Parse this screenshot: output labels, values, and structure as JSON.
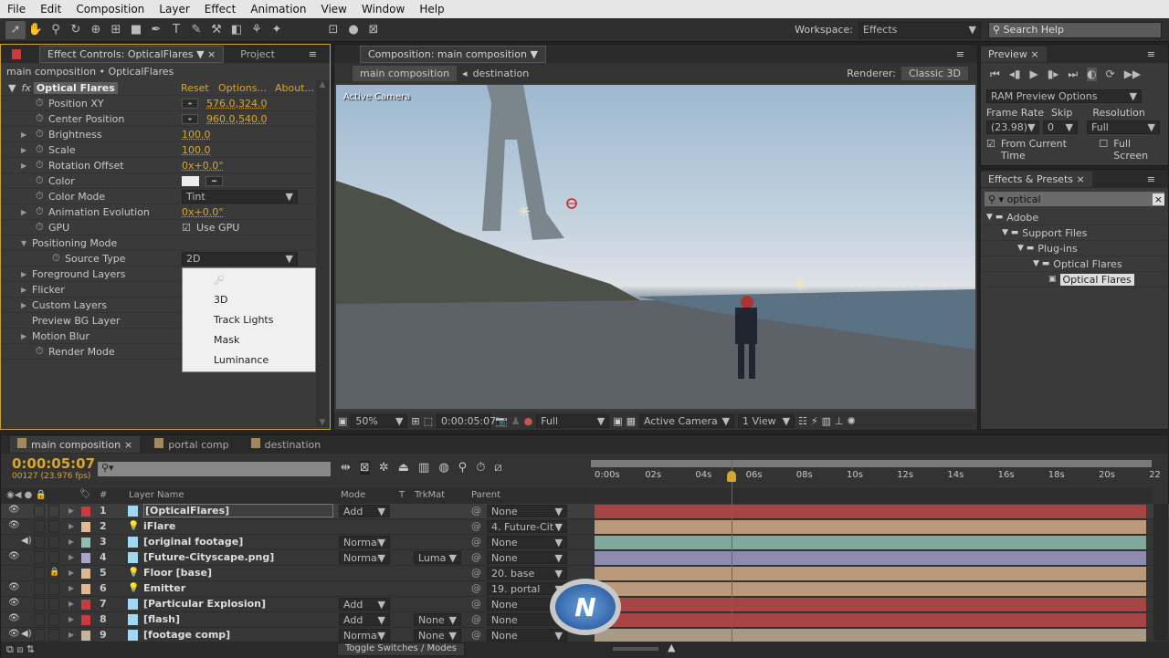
{
  "menu": [
    "File",
    "Edit",
    "Composition",
    "Layer",
    "Effect",
    "Animation",
    "View",
    "Window",
    "Help"
  ],
  "toolbar": {
    "workspace_label": "Workspace:",
    "workspace_value": "Effects",
    "search_placeholder": "Search Help"
  },
  "effect_controls": {
    "tab": "Effect Controls: OpticalFlares",
    "tab2": "Project",
    "breadcrumb": "main composition • OpticalFlares",
    "effect_name": "Optical Flares",
    "reset": "Reset",
    "options": "Options...",
    "about": "About...",
    "params": [
      {
        "label": "Position XY",
        "value": "576.0,324.0"
      },
      {
        "label": "Center Position",
        "value": "960.0,540.0"
      },
      {
        "label": "Brightness",
        "value": "100.0"
      },
      {
        "label": "Scale",
        "value": "100.0"
      },
      {
        "label": "Rotation Offset",
        "value": "0x+0.0°"
      },
      {
        "label": "Color",
        "value": ""
      },
      {
        "label": "Color Mode",
        "value": "Tint"
      },
      {
        "label": "Animation Evolution",
        "value": "0x+0.0°"
      },
      {
        "label": "GPU",
        "value": "Use GPU"
      },
      {
        "label": "Positioning Mode",
        "value": ""
      },
      {
        "label": "Source Type",
        "value": "2D"
      },
      {
        "label": "Foreground Layers",
        "value": ""
      },
      {
        "label": "Flicker",
        "value": ""
      },
      {
        "label": "Custom Layers",
        "value": ""
      },
      {
        "label": "Preview BG Layer",
        "value": ""
      },
      {
        "label": "Motion Blur",
        "value": ""
      },
      {
        "label": "Render Mode",
        "value": ""
      }
    ],
    "dropdown_options": [
      "2D",
      "3D",
      "Track Lights",
      "Mask",
      "Luminance"
    ]
  },
  "composition": {
    "tab": "Composition: main composition",
    "crumbs": [
      "main composition",
      "destination"
    ],
    "renderer_label": "Renderer:",
    "renderer": "Classic 3D",
    "camera_label": "Active Camera",
    "footer": {
      "zoom": "50%",
      "time": "0:00:05:07",
      "resolution": "Full",
      "camera": "Active Camera",
      "views": "1 View"
    }
  },
  "preview": {
    "title": "Preview",
    "ram_options": "RAM Preview Options",
    "frame_rate_label": "Frame Rate",
    "frame_rate": "(23.98)",
    "skip_label": "Skip",
    "skip": "0",
    "resolution_label": "Resolution",
    "resolution": "Full",
    "from_current": "From Current Time",
    "full_screen": "Full Screen",
    "from_current_checked": true,
    "full_screen_checked": false
  },
  "effects_presets": {
    "title": "Effects & Presets",
    "search": "optical",
    "tree": [
      "Adobe",
      "Support Files",
      "Plug-ins",
      "Optical Flares",
      "Optical Flares"
    ]
  },
  "timeline": {
    "tabs": [
      "main composition",
      "portal comp",
      "destination"
    ],
    "timecode": "0:00:05:07",
    "frame_info": "00127 (23.976 fps)",
    "headers": {
      "num": "#",
      "layer_name": "Layer Name",
      "mode": "Mode",
      "t": "T",
      "trkmat": "TrkMat",
      "parent": "Parent"
    },
    "ruler": [
      "0:00s",
      "02s",
      "04s",
      "06s",
      "08s",
      "10s",
      "12s",
      "14s",
      "16s",
      "18s",
      "20s",
      "22"
    ],
    "playhead_seconds": 5.3,
    "layers": [
      {
        "n": "1",
        "name": "[OpticalFlares]",
        "color": "#c83c3c",
        "mode": "Add",
        "trkmat": "",
        "parent": "None",
        "bar": "#a84444",
        "eye": true
      },
      {
        "n": "2",
        "name": "iFlare",
        "color": "#e0b896",
        "mode": "",
        "trkmat": "",
        "parent": "4. Future-Cit",
        "bar": "#bb9a7c",
        "eye": true
      },
      {
        "n": "3",
        "name": "[original footage]",
        "color": "#8fbfb0",
        "mode": "Normal",
        "trkmat": "",
        "parent": "None",
        "bar": "#7ea99b",
        "eye": false
      },
      {
        "n": "4",
        "name": "[Future-Cityscape.png]",
        "color": "#a8a4cc",
        "mode": "Normal",
        "trkmat": "Luma",
        "parent": "None",
        "bar": "#8e8cae",
        "eye": true
      },
      {
        "n": "5",
        "name": "Floor [base]",
        "color": "#e0b896",
        "mode": "",
        "trkmat": "",
        "parent": "20. base",
        "bar": "#bb9a7c",
        "eye": false
      },
      {
        "n": "6",
        "name": "Emitter",
        "color": "#e0b896",
        "mode": "",
        "trkmat": "",
        "parent": "19. portal",
        "bar": "#bb9a7c",
        "eye": true
      },
      {
        "n": "7",
        "name": "[Particular Explosion]",
        "color": "#c83c3c",
        "mode": "Add",
        "trkmat": "",
        "parent": "None",
        "bar": "#a84444",
        "eye": true
      },
      {
        "n": "8",
        "name": "[flash]",
        "color": "#c83c3c",
        "mode": "Add",
        "trkmat": "None",
        "parent": "None",
        "bar": "#a84444",
        "eye": true
      },
      {
        "n": "9",
        "name": "[footage comp]",
        "color": "#c4b49c",
        "mode": "Normal",
        "trkmat": "None",
        "parent": "None",
        "bar": "#a89a84",
        "eye": true
      }
    ],
    "toggle": "Toggle Switches / Modes"
  }
}
